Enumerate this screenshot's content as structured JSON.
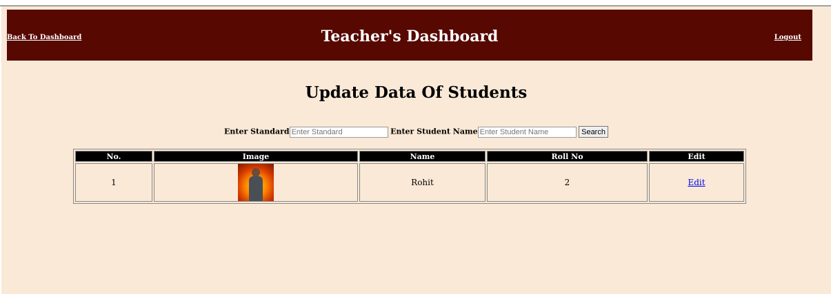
{
  "header": {
    "back_link": "Back To Dashboard",
    "title": "Teacher's Dashboard",
    "logout_link": "Logout"
  },
  "page_title": "Update Data Of Students",
  "search": {
    "standard_label": "Enter Standard",
    "standard_placeholder": "Enter Standard",
    "name_label": "Enter Student Name",
    "name_placeholder": "Enter Student Name",
    "button_label": "Search"
  },
  "table": {
    "headers": [
      "No.",
      "Image",
      "Name",
      "Roll No",
      "Edit"
    ],
    "rows": [
      {
        "no": "1",
        "image_icon": "student-photo",
        "name": "Rohit",
        "roll_no": "2",
        "edit": "Edit"
      }
    ]
  },
  "colors": {
    "header_bg": "#560801",
    "page_bg": "#f9e9d6",
    "table_header_bg": "#000000",
    "link": "#0000ee"
  }
}
